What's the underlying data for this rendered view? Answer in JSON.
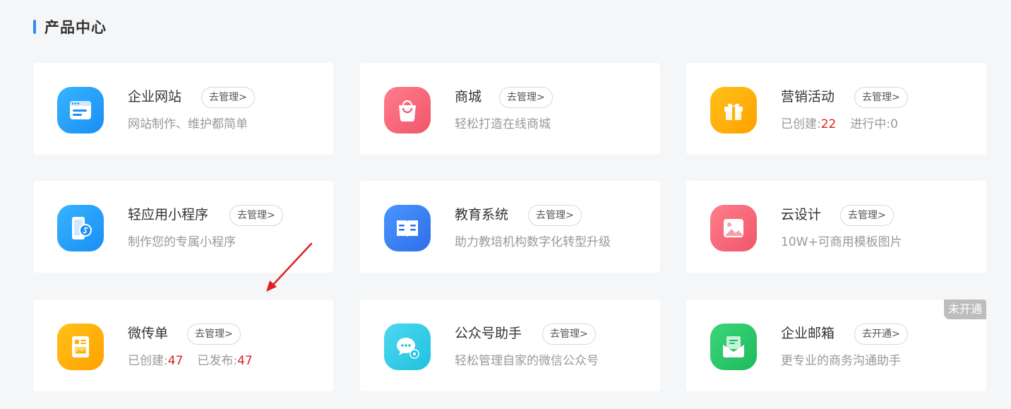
{
  "section": {
    "title": "产品中心"
  },
  "cards": [
    {
      "title": "企业网站",
      "button": "去管理>",
      "desc": "网站制作、维护都简单"
    },
    {
      "title": "商城",
      "button": "去管理>",
      "desc": "轻松打造在线商城"
    },
    {
      "title": "营销活动",
      "button": "去管理>",
      "stat1_label": "已创建:",
      "stat1_value": "22",
      "stat2_label": "进行中:",
      "stat2_value": "0"
    },
    {
      "title": "轻应用小程序",
      "button": "去管理>",
      "desc": "制作您的专属小程序"
    },
    {
      "title": "教育系统",
      "button": "去管理>",
      "desc": "助力教培机构数字化转型升级"
    },
    {
      "title": "云设计",
      "button": "去管理>",
      "desc": "10W+可商用模板图片"
    },
    {
      "title": "微传单",
      "button": "去管理>",
      "stat1_label": "已创建:",
      "stat1_value": "47",
      "stat2_label": "已发布:",
      "stat2_value": "47"
    },
    {
      "title": "公众号助手",
      "button": "去管理>",
      "desc": "轻松管理自家的微信公众号"
    },
    {
      "title": "企业邮箱",
      "button": "去开通>",
      "desc": "更专业的商务沟通助手",
      "badge": "未开通"
    }
  ],
  "icons": [
    "browser-window-icon",
    "shopping-bag-icon",
    "gift-icon",
    "mini-program-icon",
    "open-book-icon",
    "image-icon",
    "flyer-icon",
    "wechat-chat-icon",
    "mail-icon"
  ],
  "colors": {
    "accent": "#2f8cea",
    "stat_red": "#e02020",
    "arrow_red": "#e02020",
    "badge_gray": "#bdbdbd"
  }
}
